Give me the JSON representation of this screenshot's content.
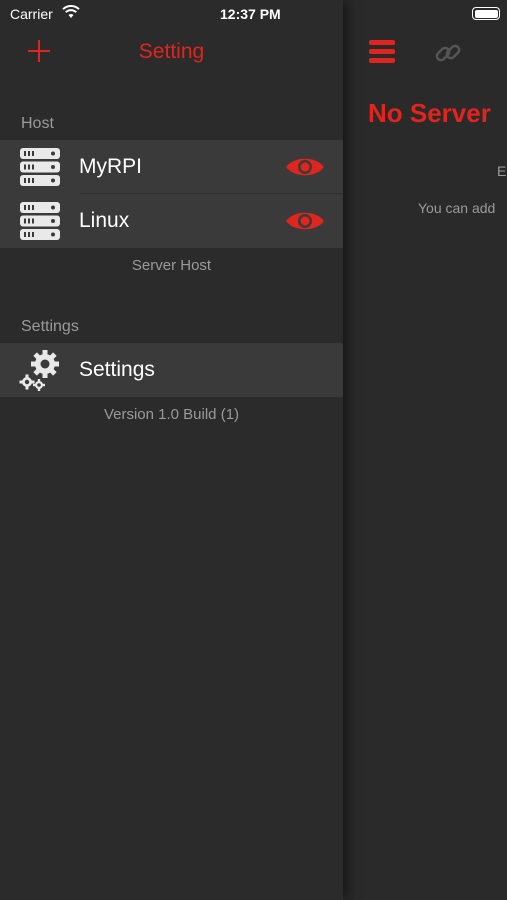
{
  "status_bar": {
    "carrier": "Carrier",
    "time": "12:37 PM",
    "icons": [
      "wifi-icon",
      "battery-icon"
    ]
  },
  "drawer": {
    "title": "Setting",
    "add_icon": "plus-icon",
    "sections": {
      "host": {
        "header": "Host",
        "items": [
          {
            "label": "MyRPI",
            "icon": "server-icon",
            "action_icon": "eye-icon"
          },
          {
            "label": "Linux",
            "icon": "server-icon",
            "action_icon": "eye-icon"
          }
        ],
        "footer": "Server Host"
      },
      "settings": {
        "header": "Settings",
        "items": [
          {
            "label": "Settings",
            "icon": "gears-icon"
          }
        ],
        "footer": "Version 1.0 Build (1)"
      }
    }
  },
  "main": {
    "menu_icon": "hamburger-icon",
    "link_icon": "link-icon",
    "title": "No Server",
    "empty_hint": "E",
    "add_hint": "You can add"
  },
  "colors": {
    "accent": "#e0241e",
    "background": "#2b2b2b",
    "row_background": "#3a3a3a",
    "secondary_text": "#9a9a9a"
  }
}
